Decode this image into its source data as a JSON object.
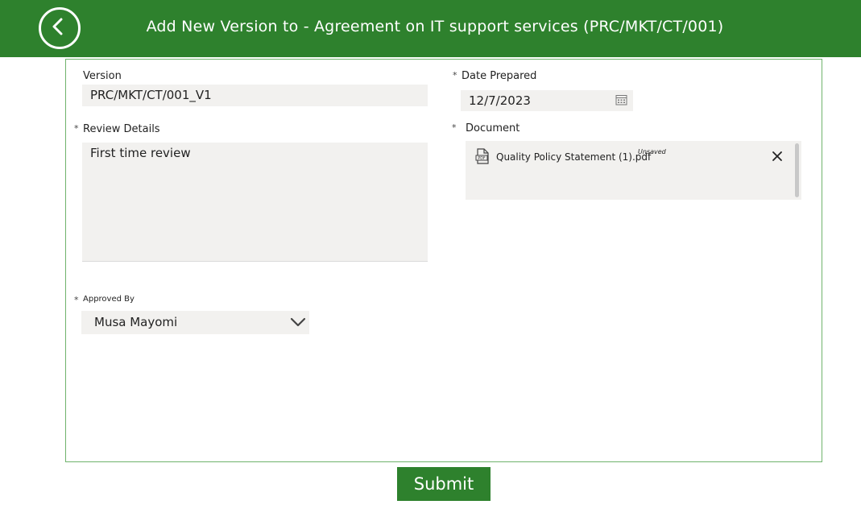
{
  "header": {
    "title": "Add New Version to - Agreement on IT support services (PRC/MKT/CT/001)",
    "back_icon": "chevron-left-icon",
    "background": "#2e812d"
  },
  "form": {
    "version": {
      "label": "Version",
      "value": "PRC/MKT/CT/001_V1"
    },
    "date_prepared": {
      "required_mark": "*",
      "label": "Date Prepared",
      "value": "12/7/2023",
      "icon": "calendar-icon"
    },
    "review_details": {
      "required_mark": "*",
      "label": "Review Details",
      "value": "First time review"
    },
    "document": {
      "required_mark": "*",
      "label": "Document",
      "file_name": "Quality Policy Statement (1).pdf",
      "status": "Unsaved",
      "file_icon": "pdf-icon",
      "remove_icon": "close-icon"
    },
    "approved_by": {
      "required_mark": "*",
      "label": "Approved By",
      "value": "Musa Mayomi",
      "icon": "chevron-down-icon"
    }
  },
  "submit_label": "Submit",
  "accent_color": "#2e812d"
}
